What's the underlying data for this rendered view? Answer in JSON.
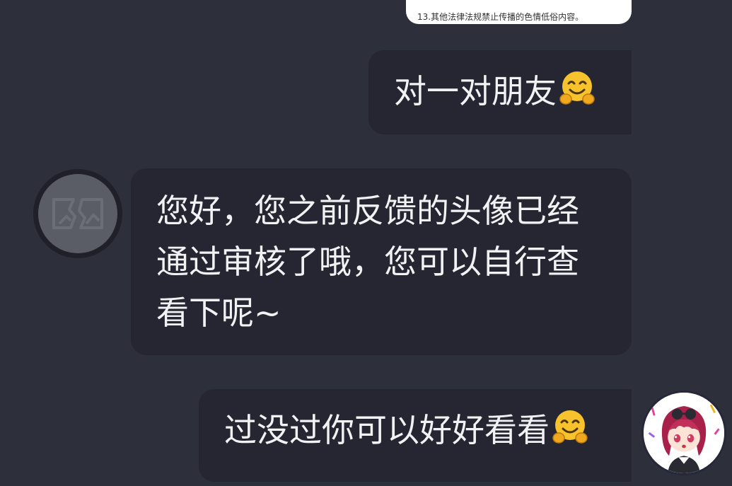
{
  "top_card": {
    "text": "13.其他法律法规禁止传播的色情低俗内容。"
  },
  "messages": [
    {
      "side": "right",
      "text": "对一对朋友",
      "emoji": "hugging-face-icon"
    },
    {
      "side": "left",
      "text": "您好，您之前反馈的头像已经通过审核了哦，您可以自行查看下呢~"
    },
    {
      "side": "right",
      "text": "过没过你可以好好看看",
      "emoji": "hugging-face-icon"
    }
  ],
  "colors": {
    "background": "#2d2f3a",
    "bubble": "#252631",
    "text": "#f2f2f5",
    "card": "#ffffff"
  }
}
